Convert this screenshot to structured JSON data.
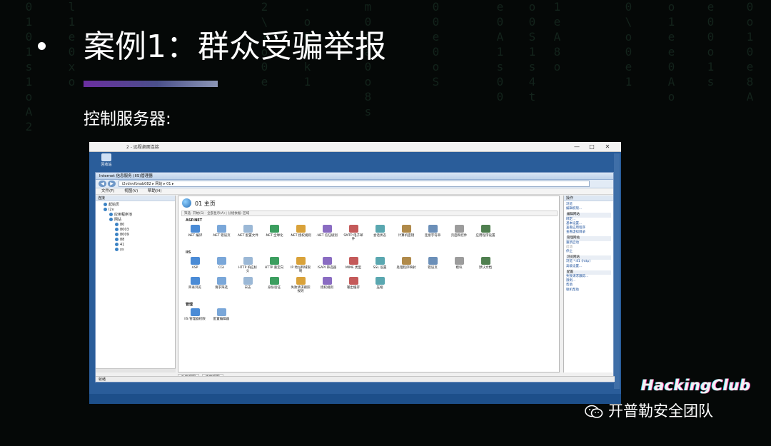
{
  "slide": {
    "title": "案例1：群众受骗举报",
    "subtitle": "控制服务器:",
    "accent_gradient": [
      "#6b2fa0",
      "#8c96b5"
    ]
  },
  "watermark": {
    "logo": "HackingClub",
    "brand": "开普勒安全团队"
  },
  "rdp": {
    "title": "2 - 远程桌面连接",
    "controls": [
      "—",
      "□",
      "✕"
    ],
    "desktop_icon": "回收站"
  },
  "iis": {
    "window_title": "Internet 信息服务 (IIS)管理器",
    "address": "i2vdnvfbnab082 ▸ 网站 ▸ 01 ▸",
    "menu": [
      "文件(F)",
      "视图(V)",
      "帮助(H)"
    ],
    "connections_header": "连接",
    "tree": [
      "起始页",
      "i2v",
      "应用程序池",
      "网站",
      "80",
      "8003",
      "8009",
      "88",
      "41",
      "ys"
    ],
    "page_title": "01 主页",
    "filter_text": "筛选:   开始(G) ·  全部显示(A)  | 分组依据: 区域",
    "sections": {
      "aspnet": "ASP.NET",
      "iis": "IIS",
      "manage": "管理"
    },
    "aspnet_features": [
      ".NET 编译",
      ".NET 错误页",
      ".NET 配置文件",
      ".NET 全球化",
      ".NET 授权规则",
      ".NET 信任级别",
      "SMTP 电子邮件",
      "会话状态",
      "计算机密钥",
      "连接字符串",
      "页面和控件",
      "应用程序设置"
    ],
    "iis_features_row1": [
      "ASP",
      "CGI",
      "HTTP 响应标头",
      "HTTP 重定向",
      "IP 地址和域限制",
      "ISAPI 筛选器",
      "MIME 类型",
      "SSL 设置",
      "处理程序映射",
      "错误页",
      "模块",
      "默认文档"
    ],
    "iis_features_row2": [
      "目录浏览",
      "请求筛选",
      "日志",
      "身份验证",
      "失败请求跟踪规则",
      "授权规则",
      "输出缓存",
      "压缩"
    ],
    "manage_features": [
      "IIS 管理器权限",
      "配置编辑器"
    ],
    "bottom_tabs": [
      "功能视图",
      "内容视图"
    ],
    "actions_header": "操作",
    "actions": [
      {
        "t": "浏览",
        "k": "link"
      },
      {
        "t": "编辑权限...",
        "k": "link"
      },
      {
        "t": "编辑网站",
        "k": "group"
      },
      {
        "t": "绑定...",
        "k": "link"
      },
      {
        "t": "基本设置...",
        "k": "link"
      },
      {
        "t": "查看应用程序",
        "k": "link"
      },
      {
        "t": "查看虚拟目录",
        "k": "link"
      },
      {
        "t": "管理网站",
        "k": "group"
      },
      {
        "t": "重新启动",
        "k": "link"
      },
      {
        "t": "启动",
        "k": "dim"
      },
      {
        "t": "停止",
        "k": "link"
      },
      {
        "t": "浏览网站",
        "k": "group"
      },
      {
        "t": "浏览 *:81 (http)",
        "k": "link"
      },
      {
        "t": "高级设置...",
        "k": "link"
      },
      {
        "t": "配置",
        "k": "group"
      },
      {
        "t": "失败请求跟踪...",
        "k": "link"
      },
      {
        "t": "限制...",
        "k": "link"
      },
      {
        "t": "帮助",
        "k": "link"
      },
      {
        "t": "联机帮助",
        "k": "link"
      }
    ],
    "status": "就绪"
  }
}
